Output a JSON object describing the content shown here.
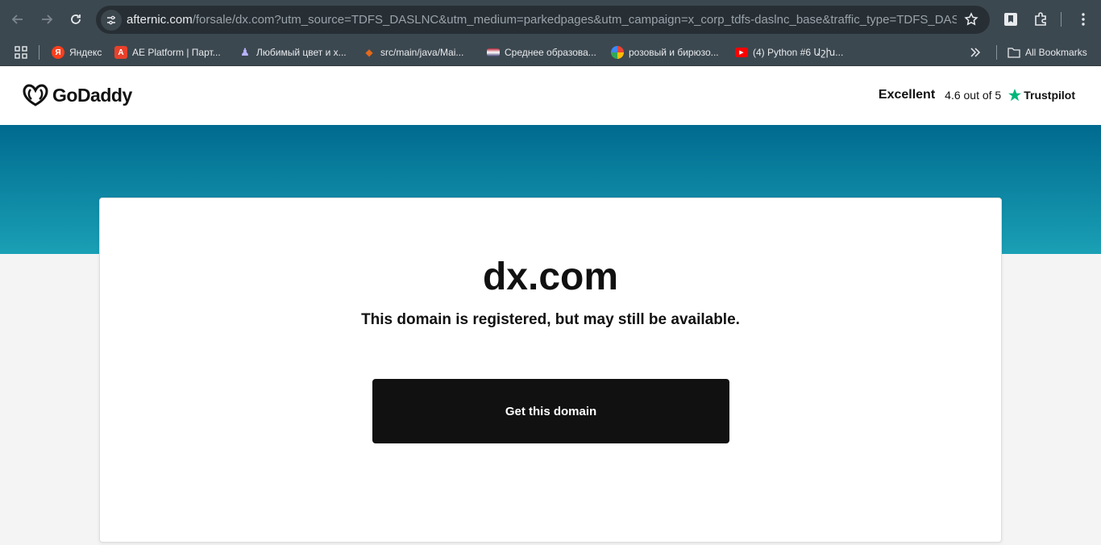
{
  "browser": {
    "url_host": "afternic.com",
    "url_path": "/forsale/dx.com?utm_source=TDFS_DASLNC&utm_medium=parkedpages&utm_campaign=x_corp_tdfs-daslnc_base&traffic_type=TDFS_DASLNC&traf...",
    "bookmarks": [
      {
        "label": "Яндекс",
        "icon": "yandex-icon",
        "color": "#fc3f1d",
        "glyph": "Я"
      },
      {
        "label": "AE Platform | Парт...",
        "icon": "ae-platform-icon",
        "color": "#e8412b",
        "glyph": "A"
      },
      {
        "label": "Любимый цвет и х...",
        "icon": "person-icon",
        "color": "#5a4fa8",
        "glyph": "♟"
      },
      {
        "label": "src/main/java/Mai...",
        "icon": "gitlab-icon",
        "color": "#e2691a",
        "glyph": "◆"
      },
      {
        "label": "Среднее образова...",
        "icon": "flag-icon",
        "color": "#b84a5a",
        "glyph": "▬"
      },
      {
        "label": "розовый и бирюзо...",
        "icon": "google-icon",
        "color": "#4285f4",
        "glyph": "G"
      },
      {
        "label": "(4) Python #6 Աշխ...",
        "icon": "youtube-icon",
        "color": "#ff0000",
        "glyph": "▶"
      }
    ],
    "all_bookmarks": "All Bookmarks"
  },
  "site": {
    "logo": "GoDaddy",
    "trustpilot": {
      "excellent": "Excellent",
      "rating": "4.6 out of 5",
      "brand": "Trustpilot",
      "star_color": "#00b67a"
    },
    "domain": "dx.com",
    "subtitle": "This domain is registered, but may still be available.",
    "cta": "Get this domain"
  },
  "colors": {
    "hero_top": "#006a8f",
    "hero_bottom": "#1aa0b5",
    "button": "#111111"
  }
}
